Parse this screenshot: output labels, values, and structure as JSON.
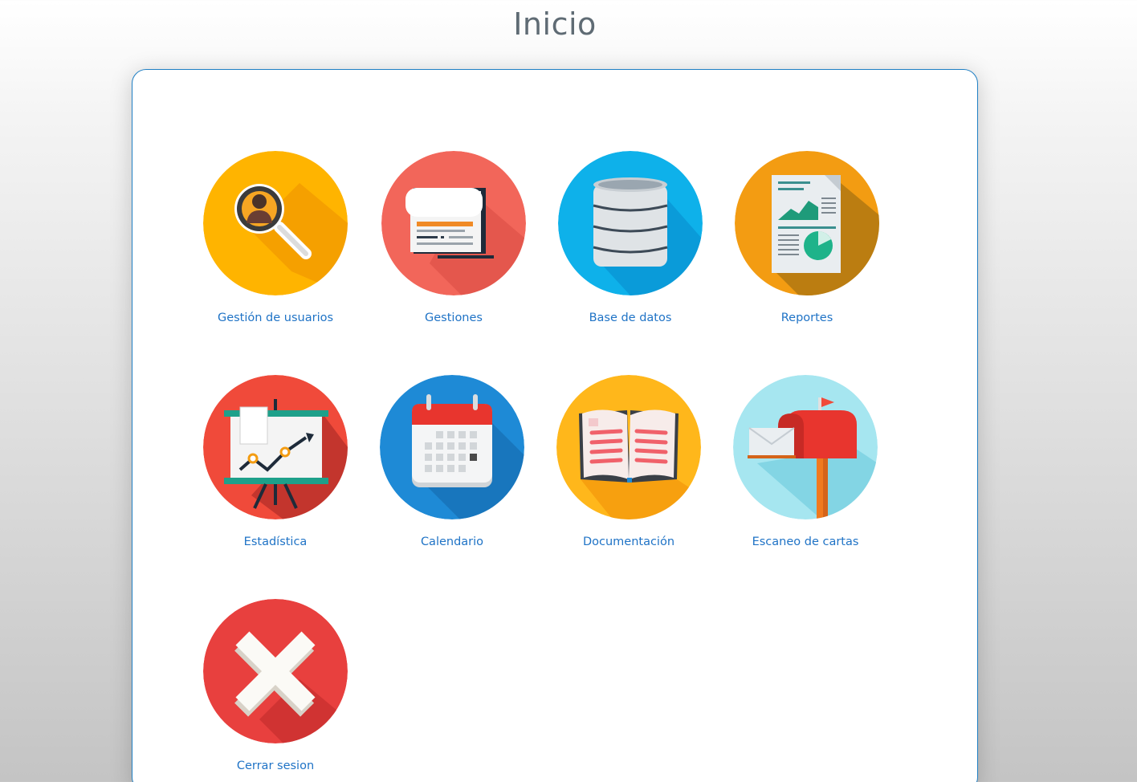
{
  "page": {
    "title": "Inicio"
  },
  "menu": {
    "items": [
      {
        "label": "Gestión de usuarios",
        "icon": "user-search-icon",
        "color": "#ffb400"
      },
      {
        "label": "Gestiones",
        "icon": "document-scroll-icon",
        "color": "#f2665a"
      },
      {
        "label": "Base de datos",
        "icon": "database-icon",
        "color": "#0eb1ea"
      },
      {
        "label": "Reportes",
        "icon": "report-icon",
        "color": "#f39c12"
      },
      {
        "label": "Estadística",
        "icon": "statistics-board-icon",
        "color": "#f04a3a"
      },
      {
        "label": "Calendario",
        "icon": "calendar-icon",
        "color": "#1e8ad6"
      },
      {
        "label": "Documentación",
        "icon": "open-book-icon",
        "color": "#ffb71b"
      },
      {
        "label": "Escaneo de cartas",
        "icon": "mailbox-icon",
        "color": "#a6e6f0"
      },
      {
        "label": "Cerrar sesion",
        "icon": "close-x-icon",
        "color": "#e8403e"
      }
    ]
  },
  "theme": {
    "accent": "#1f73c6",
    "title_color": "#5f6b74",
    "panel_border": "#1f7fc4"
  }
}
